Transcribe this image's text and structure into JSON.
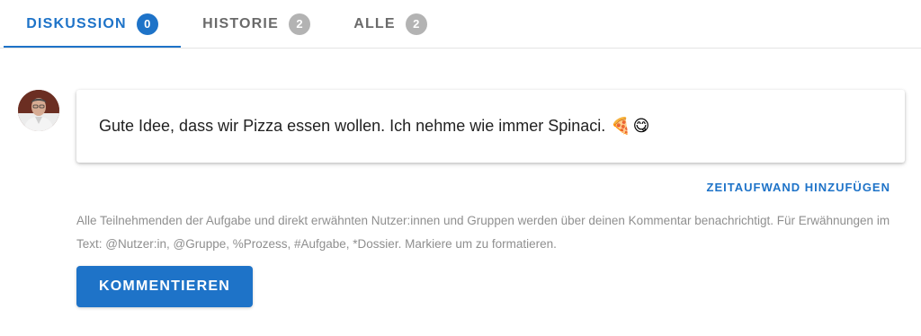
{
  "tabs": [
    {
      "label": "DISKUSSION",
      "count": "0",
      "active": true
    },
    {
      "label": "HISTORIE",
      "count": "2",
      "active": false
    },
    {
      "label": "ALLE",
      "count": "2",
      "active": false
    }
  ],
  "comment": {
    "text": "Gute Idee, dass wir Pizza essen wollen. Ich nehme wie immer Spinaci.",
    "emojis": [
      "🍕",
      "😋"
    ]
  },
  "actions": {
    "add_time_label": "ZEITAUFWAND HINZUFÜGEN",
    "submit_label": "KOMMENTIEREN"
  },
  "hint": "Alle Teilnehmenden der Aufgabe und direkt erwähnten Nutzer:innen und Gruppen werden über deinen Kommentar benachrichtigt. Für Erwähnungen im Text: @Nutzer:in, @Gruppe, %Prozess, #Aufgabe, *Dossier. Markiere um zu formatieren.",
  "colors": {
    "accent": "#1e73c8",
    "badge_inactive": "#b3b3b3",
    "text_muted": "#8f8f8f"
  }
}
